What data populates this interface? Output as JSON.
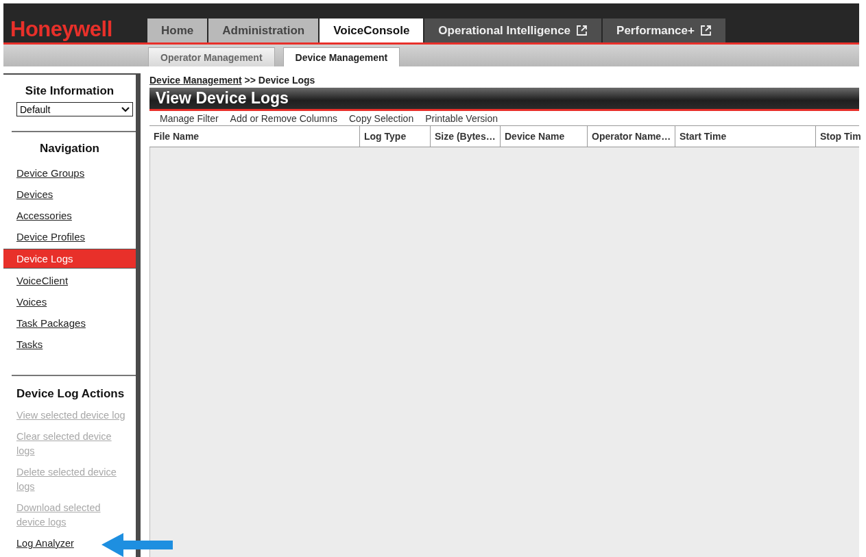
{
  "logo": "Honeywell",
  "tabs": [
    {
      "label": "Home",
      "selected": false,
      "kind": "internal"
    },
    {
      "label": "Administration",
      "selected": false,
      "kind": "internal"
    },
    {
      "label": "VoiceConsole",
      "selected": true,
      "kind": "internal"
    },
    {
      "label": "Operational Intelligence",
      "selected": false,
      "kind": "external"
    },
    {
      "label": "Performance+",
      "selected": false,
      "kind": "external"
    }
  ],
  "subtabs": [
    {
      "label": "Operator Management",
      "selected": false
    },
    {
      "label": "Device Management",
      "selected": true
    }
  ],
  "sidebar": {
    "site_heading": "Site Information",
    "site_select": "Default",
    "nav_heading": "Navigation",
    "nav_items": [
      {
        "label": "Device Groups",
        "selected": false
      },
      {
        "label": "Devices",
        "selected": false
      },
      {
        "label": "Accessories",
        "selected": false
      },
      {
        "label": "Device Profiles",
        "selected": false
      },
      {
        "label": "Device Logs",
        "selected": true
      },
      {
        "label": "VoiceClient",
        "selected": false
      },
      {
        "label": "Voices",
        "selected": false
      },
      {
        "label": "Task Packages",
        "selected": false
      },
      {
        "label": "Tasks",
        "selected": false
      }
    ],
    "actions_heading": "Device Log Actions",
    "actions": [
      {
        "label": "View selected device log",
        "disabled": true
      },
      {
        "label": "Clear selected device logs",
        "disabled": true
      },
      {
        "label": "Delete selected device logs",
        "disabled": true
      },
      {
        "label": "Download selected device logs",
        "disabled": true
      },
      {
        "label": "Log Analyzer",
        "disabled": false
      }
    ]
  },
  "breadcrumb": {
    "link": "Device Management",
    "rest": ">> Device Logs"
  },
  "page_title": "View Device Logs",
  "toolbar": [
    "Manage Filter",
    "Add or Remove Columns",
    "Copy Selection",
    "Printable Version"
  ],
  "table": {
    "columns": [
      "File Name",
      "Log Type",
      "Size (Bytes…",
      "Device Name",
      "Operator Name…",
      "Start Time",
      "Stop Tim"
    ]
  }
}
